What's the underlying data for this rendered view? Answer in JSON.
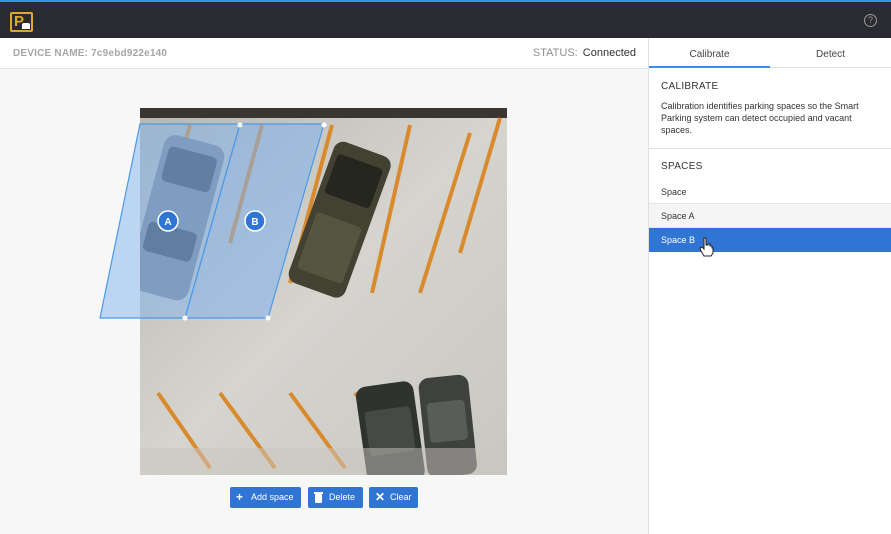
{
  "app": {
    "logo_letter": "P",
    "help_glyph": "?"
  },
  "device": {
    "name": "DEVICE NAME: 7c9ebd922e140",
    "status_label": "STATUS:",
    "status_value": "Connected"
  },
  "tabs": [
    {
      "label": "Calibrate",
      "active": true
    },
    {
      "label": "Detect",
      "active": false
    }
  ],
  "calibrate": {
    "title": "CALIBRATE",
    "description": "Calibration identifies parking spaces so the Smart Parking system can detect occupied and vacant spaces."
  },
  "spaces": {
    "title": "SPACES",
    "header": "Space",
    "items": [
      {
        "label": "Space A",
        "selected": false
      },
      {
        "label": "Space B",
        "selected": true
      }
    ]
  },
  "canvas": {
    "markers": [
      {
        "label": "A"
      },
      {
        "label": "B"
      }
    ]
  },
  "toolbar": {
    "add_label": "Add space",
    "delete_label": "Delete",
    "clear_label": "Clear"
  },
  "colors": {
    "accent": "#3175d4",
    "logo": "#e0a72a",
    "topbar": "#2a2b30",
    "region_fill": "#7fb3f0",
    "region_stroke": "#4a9ae8",
    "lane_marking": "#d98a2c"
  },
  "icons": {
    "help": "help-circle-icon",
    "add": "plus-icon",
    "delete": "trash-icon",
    "clear": "x-icon",
    "cursor": "hand-pointer-icon",
    "logo": "parking-logo-icon"
  }
}
